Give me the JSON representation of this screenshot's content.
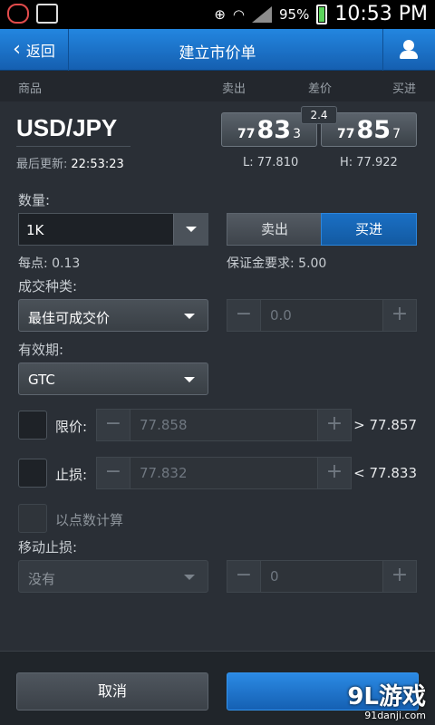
{
  "status_bar": {
    "battery": "95%",
    "time": "10:53 PM"
  },
  "nav": {
    "back_label": "返回",
    "title": "建立市价单"
  },
  "column_headers": {
    "product": "商品",
    "sell": "卖出",
    "spread": "差价",
    "buy": "买进"
  },
  "quote": {
    "pair": "USD/JPY",
    "last_update_label": "最后更新:",
    "last_update_time": "22:53:23",
    "sell": {
      "prefix": "77",
      "big": "83",
      "suffix": "3"
    },
    "buy": {
      "prefix": "77",
      "big": "85",
      "suffix": "7"
    },
    "spread": "2.4",
    "low": "L: 77.810",
    "high": "H: 77.922"
  },
  "form": {
    "quantity_label": "数量:",
    "quantity_value": "1K",
    "sell_label": "卖出",
    "buy_label": "买进",
    "pip_value": "每点: 0.13",
    "margin": "保证金要求: 5.00",
    "order_type_label": "成交种类:",
    "order_type_value": "最佳可成交价",
    "price_value": "0.0",
    "validity_label": "有效期:",
    "validity_value": "GTC",
    "limit_label": "限价:",
    "limit_value": "77.858",
    "limit_cond": "> 77.857",
    "stop_label": "止损:",
    "stop_value": "77.832",
    "stop_cond": "< 77.833",
    "points_label": "以点数计算",
    "trailing_label": "移动止损:",
    "trailing_value": "没有",
    "trailing_amount": "0",
    "minus": "−",
    "plus": "+"
  },
  "footer": {
    "cancel_label": "取消"
  },
  "watermark": {
    "text": "9L游戏",
    "url": "91danji.com"
  }
}
